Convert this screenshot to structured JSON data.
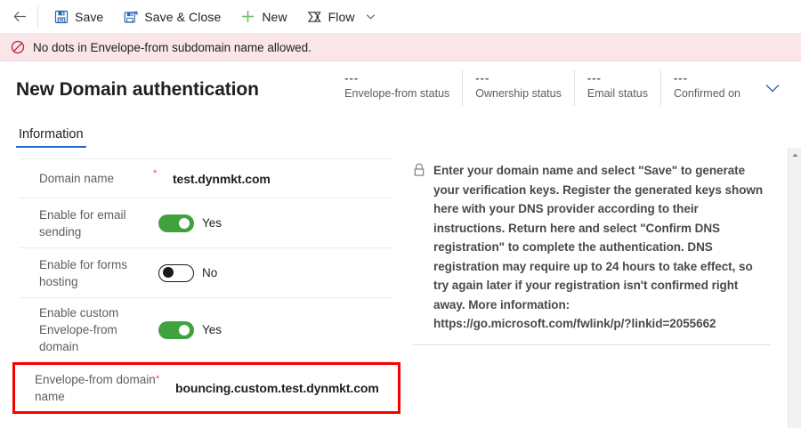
{
  "commandbar": {
    "back_icon": "back-arrow-icon",
    "buttons": [
      {
        "label": "Save",
        "icon": "save-floppy-icon"
      },
      {
        "label": "Save & Close",
        "icon": "save-and-close-icon"
      },
      {
        "label": "New",
        "icon": "plus-icon"
      },
      {
        "label": "Flow",
        "icon": "flow-icon"
      }
    ],
    "overflow_icon": "chevron-down-icon"
  },
  "error_banner": {
    "icon": "block-error-icon",
    "message": "No dots in Envelope-from subdomain name allowed."
  },
  "header": {
    "title": "New Domain authentication",
    "expand_icon": "chevron-down-icon",
    "status_fields": [
      {
        "value": "---",
        "label": "Envelope-from status"
      },
      {
        "value": "---",
        "label": "Ownership status"
      },
      {
        "value": "---",
        "label": "Email status"
      },
      {
        "value": "---",
        "label": "Confirmed on"
      }
    ]
  },
  "tabs": [
    {
      "label": "Information",
      "active": true
    }
  ],
  "form": {
    "rows": [
      {
        "label": "Domain name",
        "required": "*",
        "type": "text",
        "value": "test.dynmkt.com",
        "highlighted": false
      },
      {
        "label": "Enable for email sending",
        "required": "",
        "type": "toggle",
        "toggle_state": "on",
        "value": "Yes",
        "highlighted": false
      },
      {
        "label": "Enable for forms hosting",
        "required": "",
        "type": "toggle",
        "toggle_state": "off",
        "value": "No",
        "highlighted": false
      },
      {
        "label": "Enable custom Envelope-from domain",
        "required": "",
        "type": "toggle",
        "toggle_state": "on",
        "value": "Yes",
        "highlighted": false
      },
      {
        "label": "Envelope-from domain name",
        "required": "*",
        "type": "text",
        "value": "bouncing.custom.test.dynmkt.com",
        "highlighted": true
      }
    ]
  },
  "info_panel": {
    "icon": "lock-icon",
    "text": "Enter your domain name and select \"Save\" to generate your verification keys. Register the generated keys shown here with your DNS provider according to their instructions. Return here and select \"Confirm DNS registration\" to complete the authentication. DNS registration may require up to 24 hours to take effect, so try again later if your registration isn't confirmed right away. More information: https://go.microsoft.com/fwlink/p/?linkid=2055662"
  },
  "scrollbar": {
    "up_icon": "scroll-up-arrow-icon"
  },
  "colors": {
    "accent": "#2266cc",
    "toggle_on": "#3fa23f",
    "error_border": "#f80000",
    "error_banner_bg": "#fae5e9",
    "required_star": "#e74c3c"
  }
}
